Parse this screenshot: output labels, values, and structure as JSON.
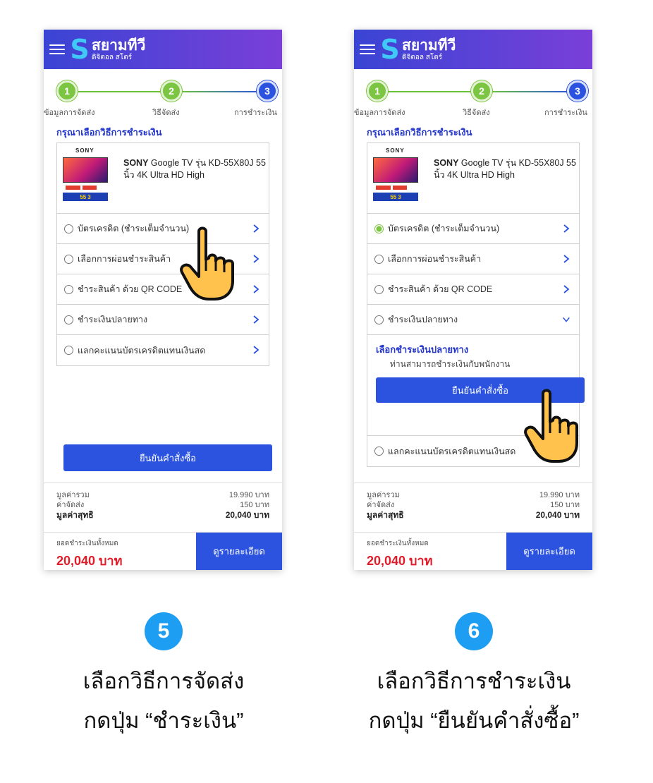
{
  "brand": {
    "name": "สยามทีวี",
    "subtitle": "ดิจิตอล สโตร์",
    "logo_letter": "S"
  },
  "steps": [
    {
      "number": "1",
      "label": "ข้อมูลการจัดส่ง"
    },
    {
      "number": "2",
      "label": "วิธีจัดส่ง"
    },
    {
      "number": "3",
      "label": "การชำระเงิน"
    }
  ],
  "section_title": "กรุณาเลือกวิธีการชำระเงิน",
  "product": {
    "brand_logo": "SONY",
    "name_bold": "SONY",
    "name_rest": " Google TV รุ่น KD-55X80J 55 นิ้ว 4K Ultra HD High",
    "banner_text": "55",
    "banner_years": "3"
  },
  "payment_options": [
    "บัตรเครดิต (ชำระเต็มจำนวน)",
    "เลือกการผ่อนชำระสินค้า",
    "ชำระสินค้า ด้วย QR CODE",
    "ชำระเงินปลายทาง",
    "แลกคะแนนบัตรเครดิตแทนเงินสด"
  ],
  "cod_panel": {
    "title": "เลือกชำระเงินปลายทาง",
    "description": "ท่านสามารถชำระเงินกับพนักงาน"
  },
  "confirm_label": "ยืนยันคำสั่งซื้อ",
  "summary": {
    "subtotal_label": "มูลค่ารวม",
    "subtotal_value": "19.990 บาท",
    "shipping_label": "ค่าจัดส่ง",
    "shipping_value": "150 บาท",
    "net_label": "มูลค่าสุทธิ",
    "net_value": "20,040 บาท"
  },
  "footer": {
    "grand_label": "ยอดชำระเงินทั้งหมด",
    "grand_value": "20,040 บาท",
    "details_label": "ดูรายละเอียด"
  },
  "instructions": [
    {
      "number": "5",
      "line1": "เลือกวิธีการจัดส่ง",
      "line2": "กดปุ่ม “ชำระเงิน”"
    },
    {
      "number": "6",
      "line1": "เลือกวิธีการชำระเงิน",
      "line2": "กดปุ่ม “ยืนยันคำสั่งซื้อ”"
    }
  ],
  "colors": {
    "accent_blue": "#2b53df",
    "step_green": "#7cc542",
    "total_red": "#e11d2a",
    "badge_blue": "#1e9ef2"
  },
  "icons": [
    "menu-icon",
    "logo-icon",
    "chevron-right-icon",
    "chevron-down-icon",
    "radio-icon",
    "hand-pointer-icon"
  ]
}
